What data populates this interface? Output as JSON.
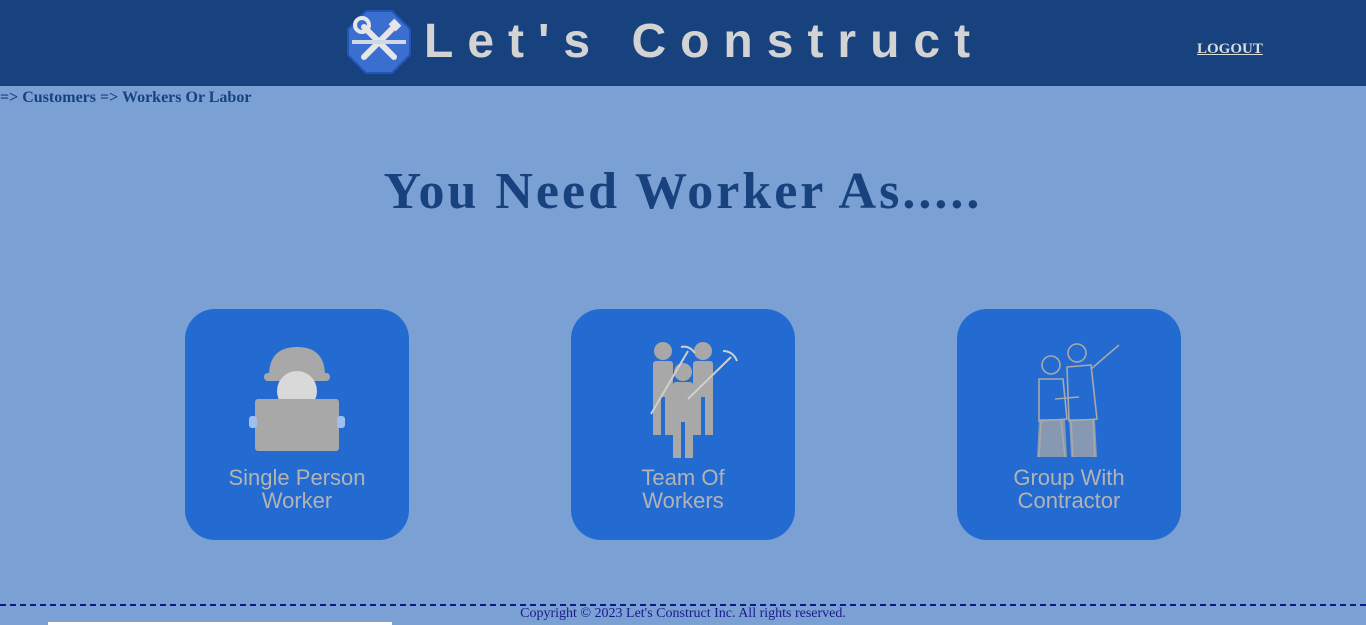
{
  "header": {
    "brand": "Let's Construct",
    "logout_label": "LOGOUT",
    "logo_icon": "tools-icon"
  },
  "breadcrumb": "=> Customers => Workers Or Labor",
  "main": {
    "heading": "You Need Worker As.....",
    "options": [
      {
        "label_line1": "Single Person",
        "label_line2": "Worker",
        "icon": "single-worker-icon"
      },
      {
        "label_line1": "Team Of",
        "label_line2": "Workers",
        "icon": "worker-team-icon"
      },
      {
        "label_line1": "Group With",
        "label_line2": "Contractor",
        "icon": "contractor-group-icon"
      }
    ]
  },
  "footer": {
    "copyright": "Copyright © 2023 Let's Construct Inc. All rights reserved."
  },
  "colors": {
    "page_bg": "#7aa0d4",
    "header_bg": "#17427e",
    "card_bg": "#236bd0",
    "heading_text": "#17427e",
    "brand_text": "#d3d3d3"
  }
}
